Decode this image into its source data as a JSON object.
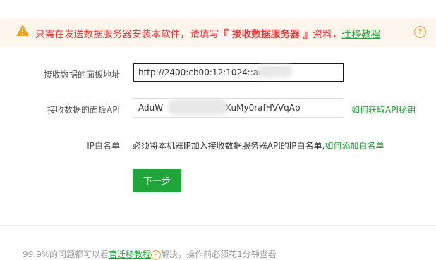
{
  "notice": {
    "text_before": "只需在发送数据服务器安装本软件，请填写",
    "highlight": "『 接收数据服务器 』",
    "text_after": "资料，",
    "link": "迁移教程",
    "help": "?"
  },
  "form": {
    "panel_address": {
      "label": "接收数据的面板地址",
      "value": "http://2400:cb00:12:1024::ac4"
    },
    "panel_api": {
      "label": "接收数据的面板API",
      "value_start": "AduW",
      "value_end": "ZXuMy0rafHVVqAp",
      "help_link": "如何获取API秘钥"
    },
    "ip_whitelist": {
      "label": "IP白名单",
      "desc": "必须将本机器IP加入接收数据服务器API的IP白名单,",
      "help_link": "如何添加白名单"
    },
    "next_button": "下一步"
  },
  "footer": {
    "text_before": "99.9%的问题都可以看",
    "link": "官迁移教程",
    "help": "?",
    "text_after": "解决，操作前必须花1分钟查看"
  },
  "colors": {
    "accent": "#20a53a",
    "warning": "#e4393c",
    "notice_bg": "#fdf6ec"
  }
}
